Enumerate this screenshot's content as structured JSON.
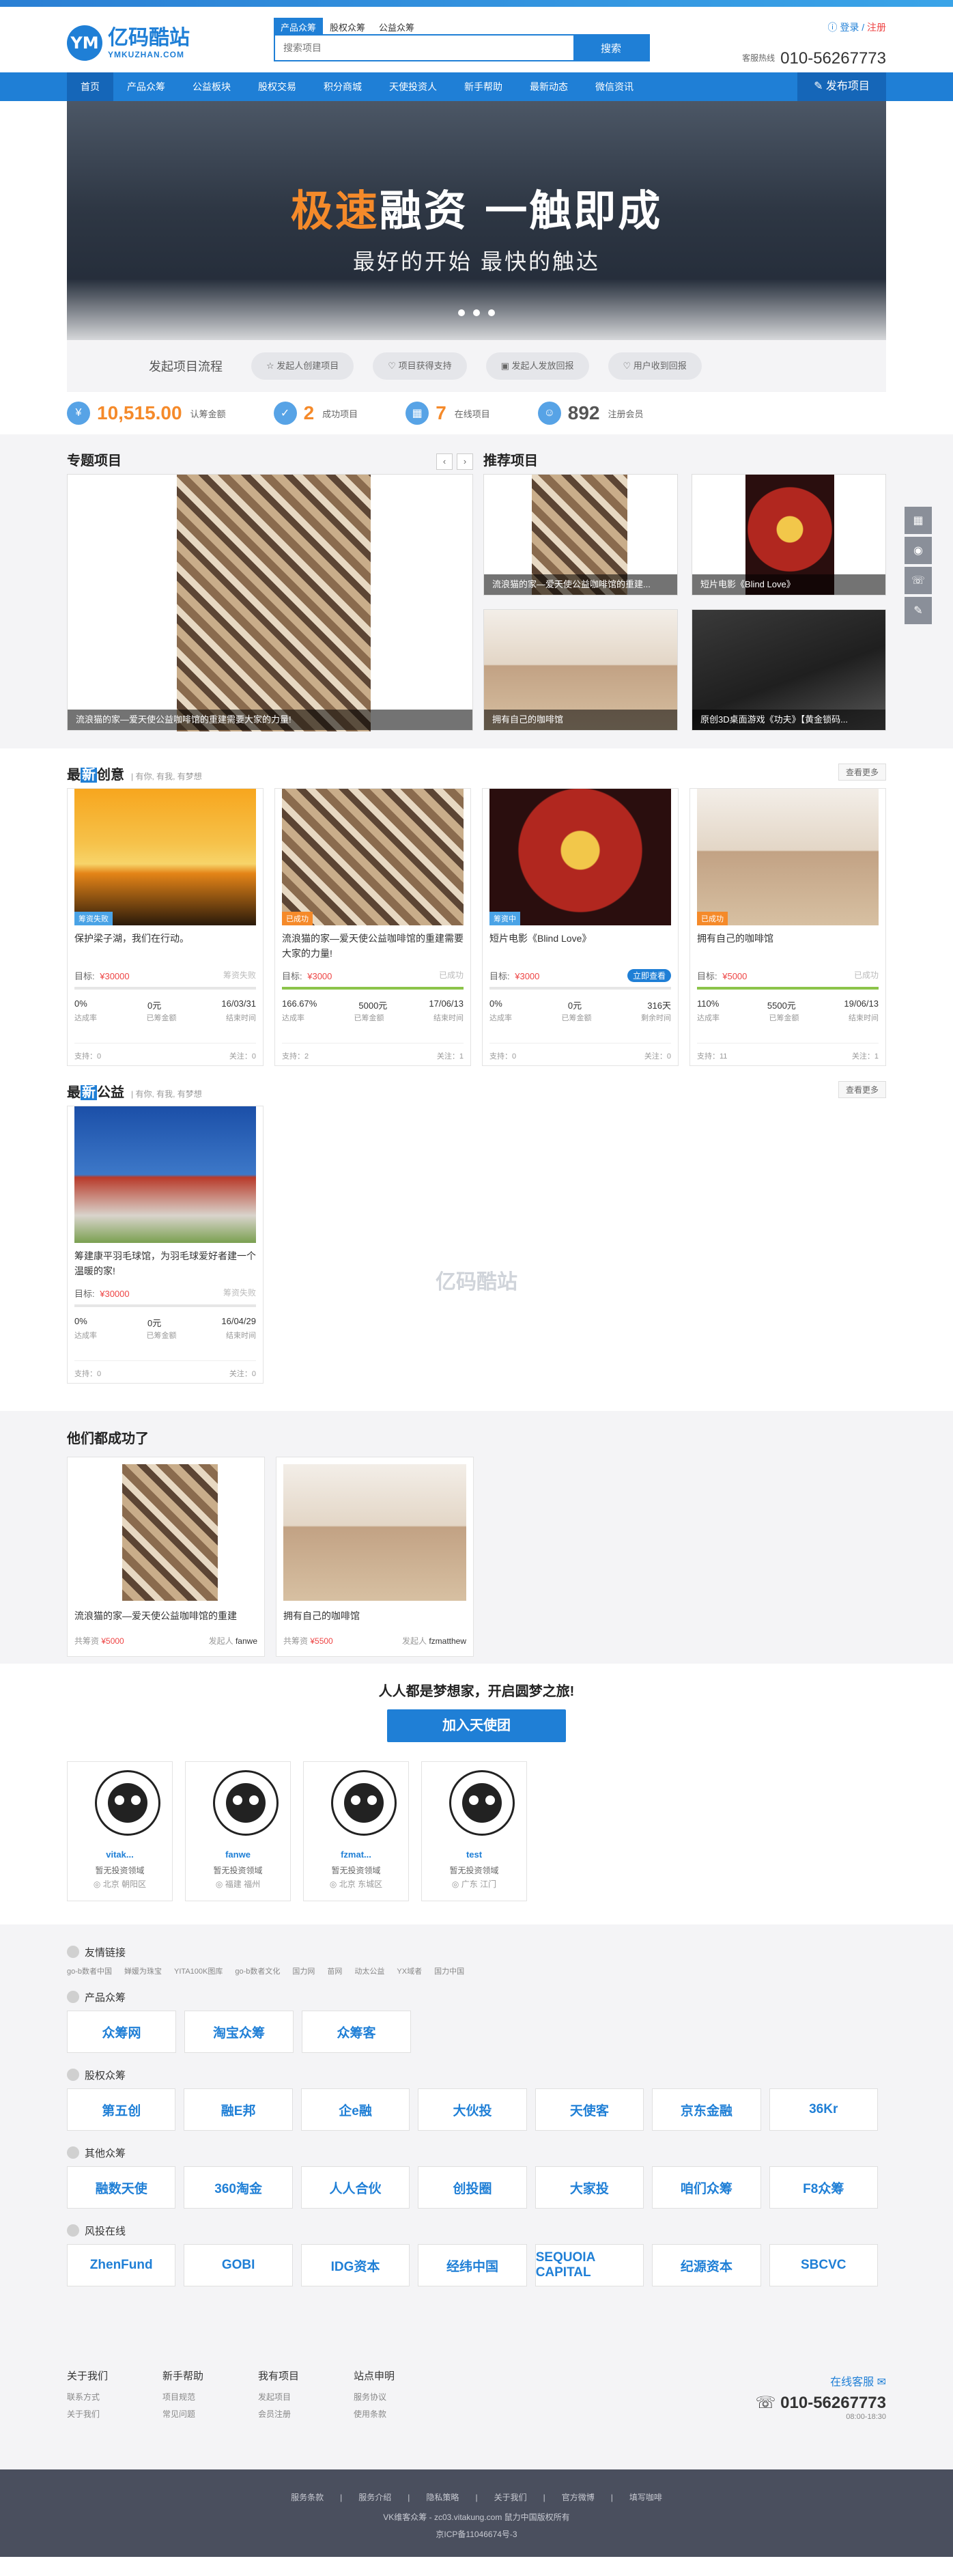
{
  "header": {
    "logo_cn": "亿码酷站",
    "logo_en": "YMKUZHAN.COM",
    "search_tabs": [
      "产品众筹",
      "股权众筹",
      "公益众筹"
    ],
    "search_placeholder": "搜索项目",
    "search_button": "搜索",
    "login": "登录",
    "register": "注册",
    "hotline_label": "客服热线",
    "hotline": "010-56267773"
  },
  "nav": {
    "items": [
      "首页",
      "产品众筹",
      "公益板块",
      "股权交易",
      "积分商城",
      "天使投资人",
      "新手帮助",
      "最新动态",
      "微信资讯"
    ],
    "publish": "发布项目"
  },
  "banner": {
    "headline_accent": "极速",
    "headline_rest": "融资 一触即成",
    "subline": "最好的开始 最快的触达",
    "slides": 3
  },
  "flow": {
    "label": "发起项目流程",
    "steps": [
      "发起人创建项目",
      "项目获得支持",
      "发起人发放回报",
      "用户收到回报"
    ]
  },
  "stats": [
    {
      "icon": "money-icon",
      "value": "10,515.00",
      "label": "认筹金额"
    },
    {
      "icon": "success-icon",
      "value": "2",
      "label": "成功项目"
    },
    {
      "icon": "online-icon",
      "value": "7",
      "label": "在线项目"
    },
    {
      "icon": "member-icon",
      "value": "892",
      "label": "注册会员"
    }
  ],
  "featured": {
    "left_title": "专题项目",
    "left_caption": "流浪猫的家—爱天使公益咖啡馆的重建需要大家的力量!",
    "right_title": "推荐项目",
    "right_items": [
      {
        "caption": "流浪猫的家—爱天使公益咖啡馆的重建...",
        "img": "img-cats"
      },
      {
        "caption": "短片电影《Blind Love》",
        "img": "img-poster"
      },
      {
        "caption": "拥有自己的咖啡馆",
        "img": "img-cafe"
      },
      {
        "caption": "原创3D桌面游戏《功夫》【黄金锁码...",
        "img": "img-kungfu"
      }
    ]
  },
  "creative": {
    "title_pre": "最",
    "title_hl": "新",
    "title_post": "创意",
    "subtitle": "| 有你, 有我, 有梦想",
    "more": "查看更多",
    "cards": [
      {
        "img": "img-sunset",
        "tag": "筹资失败",
        "tag_color": "#4aa3e6",
        "name": "保护梁子湖，我们在行动。",
        "goal": "¥30000",
        "status": "筹资失败",
        "progress": 0,
        "pct": "0%",
        "amount": "0元",
        "date": "16/03/31",
        "l1": "达成率",
        "l2": "已筹金额",
        "l3": "结束时间",
        "support": "支持：0",
        "follow": "关注：0",
        "status_style": "plain"
      },
      {
        "img": "img-cats",
        "tag": "已成功",
        "tag_color": "#f58a2a",
        "name": "流浪猫的家—爱天使公益咖啡馆的重建需要大家的力量!",
        "goal": "¥3000",
        "status": "已成功",
        "progress": 100,
        "pct": "166.67%",
        "amount": "5000元",
        "date": "17/06/13",
        "l1": "达成率",
        "l2": "已筹金额",
        "l3": "结束时间",
        "support": "支持：2",
        "follow": "关注：1",
        "status_style": "plain"
      },
      {
        "img": "img-poster",
        "tag": "筹资中",
        "tag_color": "#4aa3e6",
        "name": "短片电影《Blind Love》",
        "goal": "¥3000",
        "status": "立即查看",
        "progress": 0,
        "pct": "0%",
        "amount": "0元",
        "date": "316天",
        "l1": "达成率",
        "l2": "已筹金额",
        "l3": "剩余时间",
        "support": "支持：0",
        "follow": "关注：0",
        "status_style": "go"
      },
      {
        "img": "img-cafe",
        "tag": "已成功",
        "tag_color": "#f58a2a",
        "name": "拥有自己的咖啡馆",
        "goal": "¥5000",
        "status": "已成功",
        "progress": 100,
        "pct": "110%",
        "amount": "5500元",
        "date": "19/06/13",
        "l1": "达成率",
        "l2": "已筹金额",
        "l3": "结束时间",
        "support": "支持：11",
        "follow": "关注：1",
        "status_style": "plain"
      }
    ]
  },
  "charity": {
    "title_pre": "最",
    "title_hl": "新",
    "title_post": "公益",
    "subtitle": "| 有你, 有我, 有梦想",
    "more": "查看更多",
    "cards": [
      {
        "img": "img-building",
        "name": "筹建康平羽毛球馆，为羽毛球爱好者建一个温暖的家!",
        "goal": "¥30000",
        "status": "筹资失败",
        "progress": 0,
        "pct": "0%",
        "amount": "0元",
        "date": "16/04/29",
        "l1": "达成率",
        "l2": "已筹金额",
        "l3": "结束时间",
        "support": "支持：0",
        "follow": "关注：0"
      }
    ]
  },
  "success": {
    "title": "他们都成功了",
    "items": [
      {
        "img": "img-cats",
        "name": "流浪猫的家—爱天使公益咖啡馆的重建",
        "raised_label": "共筹资",
        "raised": "¥5000",
        "by_label": "发起人",
        "by": "fanwe"
      },
      {
        "img": "img-cafe",
        "name": "拥有自己的咖啡馆",
        "raised_label": "共筹资",
        "raised": "¥5500",
        "by_label": "发起人",
        "by": "fzmatthew"
      }
    ]
  },
  "invest": {
    "headline": "人人都是梦想家，开启圆梦之旅!",
    "button": "加入天使团",
    "users": [
      {
        "name": "vitak...",
        "desc": "暂无投资领域",
        "loc": "北京 朝阳区"
      },
      {
        "name": "fanwe",
        "desc": "暂无投资领域",
        "loc": "福建 福州"
      },
      {
        "name": "fzmat...",
        "desc": "暂无投资领域",
        "loc": "北京 东城区"
      },
      {
        "name": "test",
        "desc": "暂无投资领域",
        "loc": "广东 江门"
      }
    ]
  },
  "links": {
    "friend_title": "友情链接",
    "friend_items": [
      "go-b数者中国",
      "婵媛为珠宝",
      "YITA100K图库",
      "go-b数者文化",
      "国力网",
      "苗网",
      "动太公益",
      "YX域者",
      "国力中国"
    ],
    "groups": [
      {
        "title": "产品众筹",
        "logos": [
          "众筹网",
          "淘宝众筹",
          "众筹客"
        ]
      },
      {
        "title": "股权众筹",
        "logos": [
          "第五创",
          "融E邦",
          "企e融",
          "大伙投",
          "天使客",
          "京东金融",
          "36Kr"
        ]
      },
      {
        "title": "其他众筹",
        "logos": [
          "融数天使",
          "360淘金",
          "人人合伙",
          "创投圈",
          "大家投",
          "咱们众筹",
          "F8众筹"
        ]
      },
      {
        "title": "风投在线",
        "logos": [
          "ZhenFund",
          "GOBI",
          "IDG资本",
          "经纬中国",
          "SEQUOIA CAPITAL",
          "纪源资本",
          "SBCVC"
        ]
      }
    ]
  },
  "about": {
    "cols": [
      {
        "h": "关于我们",
        "l": [
          "联系方式",
          "关于我们"
        ]
      },
      {
        "h": "新手帮助",
        "l": [
          "项目规范",
          "常见问题"
        ]
      },
      {
        "h": "我有项目",
        "l": [
          "发起项目",
          "会员注册"
        ]
      },
      {
        "h": "站点申明",
        "l": [
          "服务协议",
          "使用条款"
        ]
      }
    ],
    "online": "在线客服",
    "phone": "010-56267773",
    "time": "08:00-18:30"
  },
  "bottom": {
    "links": [
      "服务条款",
      "服务介绍",
      "隐私策略",
      "关于我们",
      "官方微博",
      "填写咖啡"
    ],
    "copyright": "VK维客众筹 - zc03.vitakung.com 鼠力中国版权所有",
    "icp": "京ICP备11046674号-3"
  },
  "watermark": "亿码酷站"
}
